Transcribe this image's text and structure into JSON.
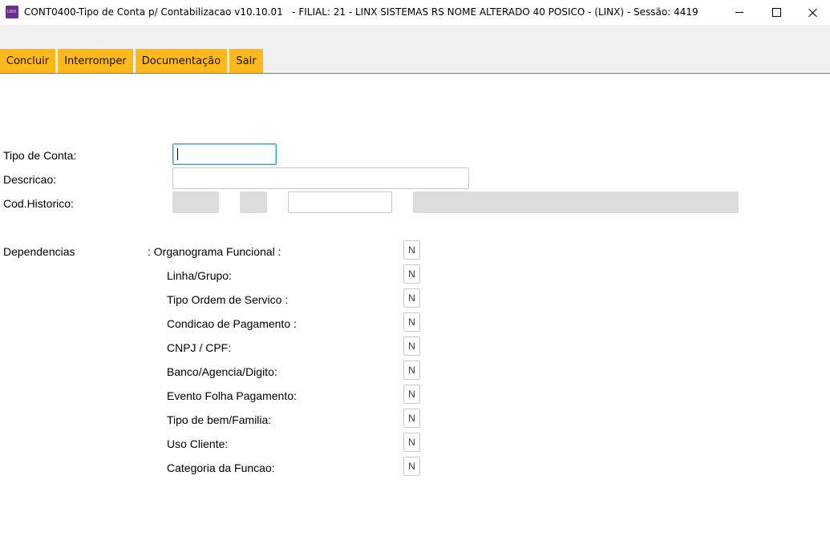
{
  "window": {
    "title": "CONT0400-Tipo de Conta p/ Contabilizacao v10.10.01   - FILIAL: 21 - LINX SISTEMAS RS NOME ALTERADO 40 POSICO - (LINX) - Sessão: 4419",
    "icon_text": "LINX"
  },
  "toolbar": {
    "concluir": "Concluir",
    "interromper": "Interromper",
    "documentacao": "Documentação",
    "sair": "Sair",
    "button_color": "#ffb81c"
  },
  "form": {
    "tipo_conta_label": "Tipo de Conta:",
    "tipo_conta_value": "",
    "descricao_label": "Descricao:",
    "descricao_value": "",
    "cod_historico_label": "Cod.Historico:",
    "cod_historico_value": "",
    "dependencias_label": "Dependencias",
    "focus_color": "#2aa0d8"
  },
  "dependencies": [
    {
      "label": ": Organograma Funcional :",
      "value": "N"
    },
    {
      "label": "Linha/Grupo:",
      "value": "N"
    },
    {
      "label": "Tipo Ordem de Servico :",
      "value": "N"
    },
    {
      "label": "Condicao de Pagamento :",
      "value": "N"
    },
    {
      "label": "CNPJ / CPF:",
      "value": "N"
    },
    {
      "label": "Banco/Agencia/Digito:",
      "value": "N"
    },
    {
      "label": "Evento Folha Pagamento:",
      "value": "N"
    },
    {
      "label": "Tipo de bem/Familia:",
      "value": "N"
    },
    {
      "label": "Uso Cliente:",
      "value": "N"
    },
    {
      "label": "Categoria da Funcao:",
      "value": "N"
    }
  ]
}
